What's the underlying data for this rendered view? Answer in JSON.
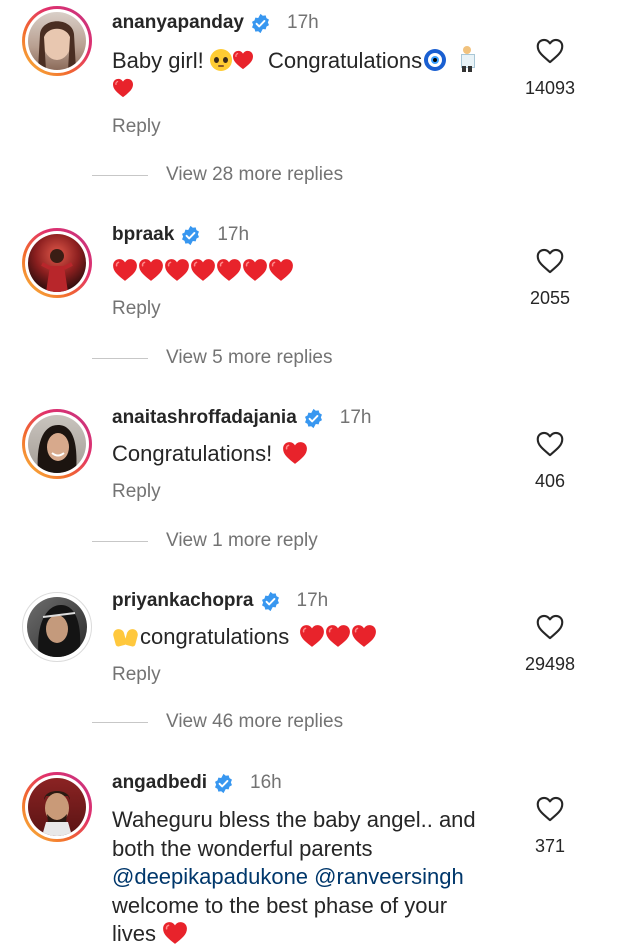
{
  "colors": {
    "accent_mention": "#00376b",
    "verified_blue": "#3897f0",
    "heart_red": "#ed2323",
    "muted": "#737373"
  },
  "comments": [
    {
      "username": "ananyapanday",
      "time": "17h",
      "text_line1": "Baby girl!",
      "text_mid": "Congratulations",
      "reply": "Reply",
      "likes": "14093",
      "view_more": "View 28 more replies"
    },
    {
      "username": "bpraak",
      "time": "17h",
      "reply": "Reply",
      "likes": "2055",
      "view_more": "View 5 more replies"
    },
    {
      "username": "anaitashroffadajania",
      "time": "17h",
      "text": "Congratulations!",
      "reply": "Reply",
      "likes": "406",
      "view_more": "View 1 more reply"
    },
    {
      "username": "priyankachopra",
      "time": "17h",
      "text": "congratulations",
      "reply": "Reply",
      "likes": "29498",
      "view_more": "View 46 more replies"
    },
    {
      "username": "angadbedi",
      "time": "16h",
      "text_line1": "Waheguru  bless the baby angel.. and",
      "text_line2": "both the wonderful parents",
      "mention1": "@deepikapadukone",
      "mention2": "@ranveersingh",
      "text_line4": "welcome to the best phase of your",
      "text_line5": "lives",
      "likes": "371"
    }
  ]
}
